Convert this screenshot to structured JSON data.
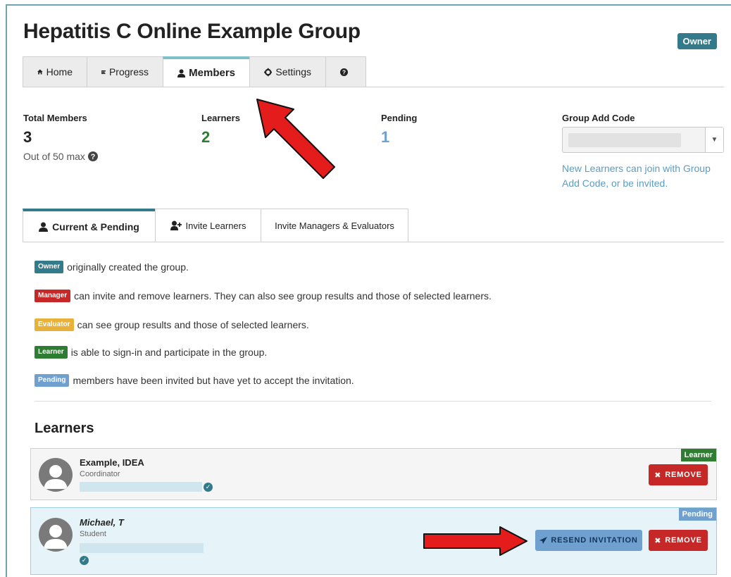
{
  "header": {
    "title": "Hepatitis C Online Example Group",
    "owner_badge": "Owner"
  },
  "nav": {
    "tabs": [
      {
        "label": "Home",
        "icon": "home-icon"
      },
      {
        "label": "Progress",
        "icon": "progress-icon"
      },
      {
        "label": "Members",
        "icon": "user-icon",
        "active": true
      },
      {
        "label": "Settings",
        "icon": "gear-icon"
      },
      {
        "label": "",
        "icon": "help-icon"
      }
    ]
  },
  "stats": {
    "total_label": "Total Members",
    "total_value": "3",
    "total_sub": "Out of 50 max",
    "learners_label": "Learners",
    "learners_value": "2",
    "pending_label": "Pending",
    "pending_value": "1",
    "code_label": "Group Add Code",
    "code_hint": "New Learners can join with Group Add Code, or be invited."
  },
  "subtabs": [
    {
      "label": "Current & Pending",
      "active": true
    },
    {
      "label": "Invite Learners"
    },
    {
      "label": "Invite Managers & Evaluators"
    }
  ],
  "legend": [
    {
      "badge": "Owner",
      "text": "originally created the group.",
      "color": "#337b8a"
    },
    {
      "badge": "Manager",
      "text": "can invite and remove learners. They can also see group results and those of selected learners.",
      "color": "#c62828"
    },
    {
      "badge": "Evaluator",
      "text": "can see group results and those of selected learners.",
      "color": "#e8b23a"
    },
    {
      "badge": "Learner",
      "text": "is able to sign-in and participate in the group.",
      "color": "#2e7d32"
    },
    {
      "badge": "Pending",
      "text": "members have been invited but have yet to accept the invitation.",
      "color": "#6fa0cf"
    }
  ],
  "learners": {
    "title": "Learners",
    "items": [
      {
        "name": "Example, IDEA",
        "role": "Coordinator",
        "status": "Learner",
        "remove_label": "REMOVE"
      },
      {
        "name": "Michael, T",
        "role": "Student",
        "status": "Pending",
        "resend_label": "RESEND INVITATION",
        "remove_label": "REMOVE"
      }
    ]
  },
  "colors": {
    "accent": "#337b8a",
    "learner_green": "#2e7d32",
    "pending_blue": "#6fa0cf",
    "danger": "#c62828",
    "annotation_arrow": "#e51c1c"
  }
}
